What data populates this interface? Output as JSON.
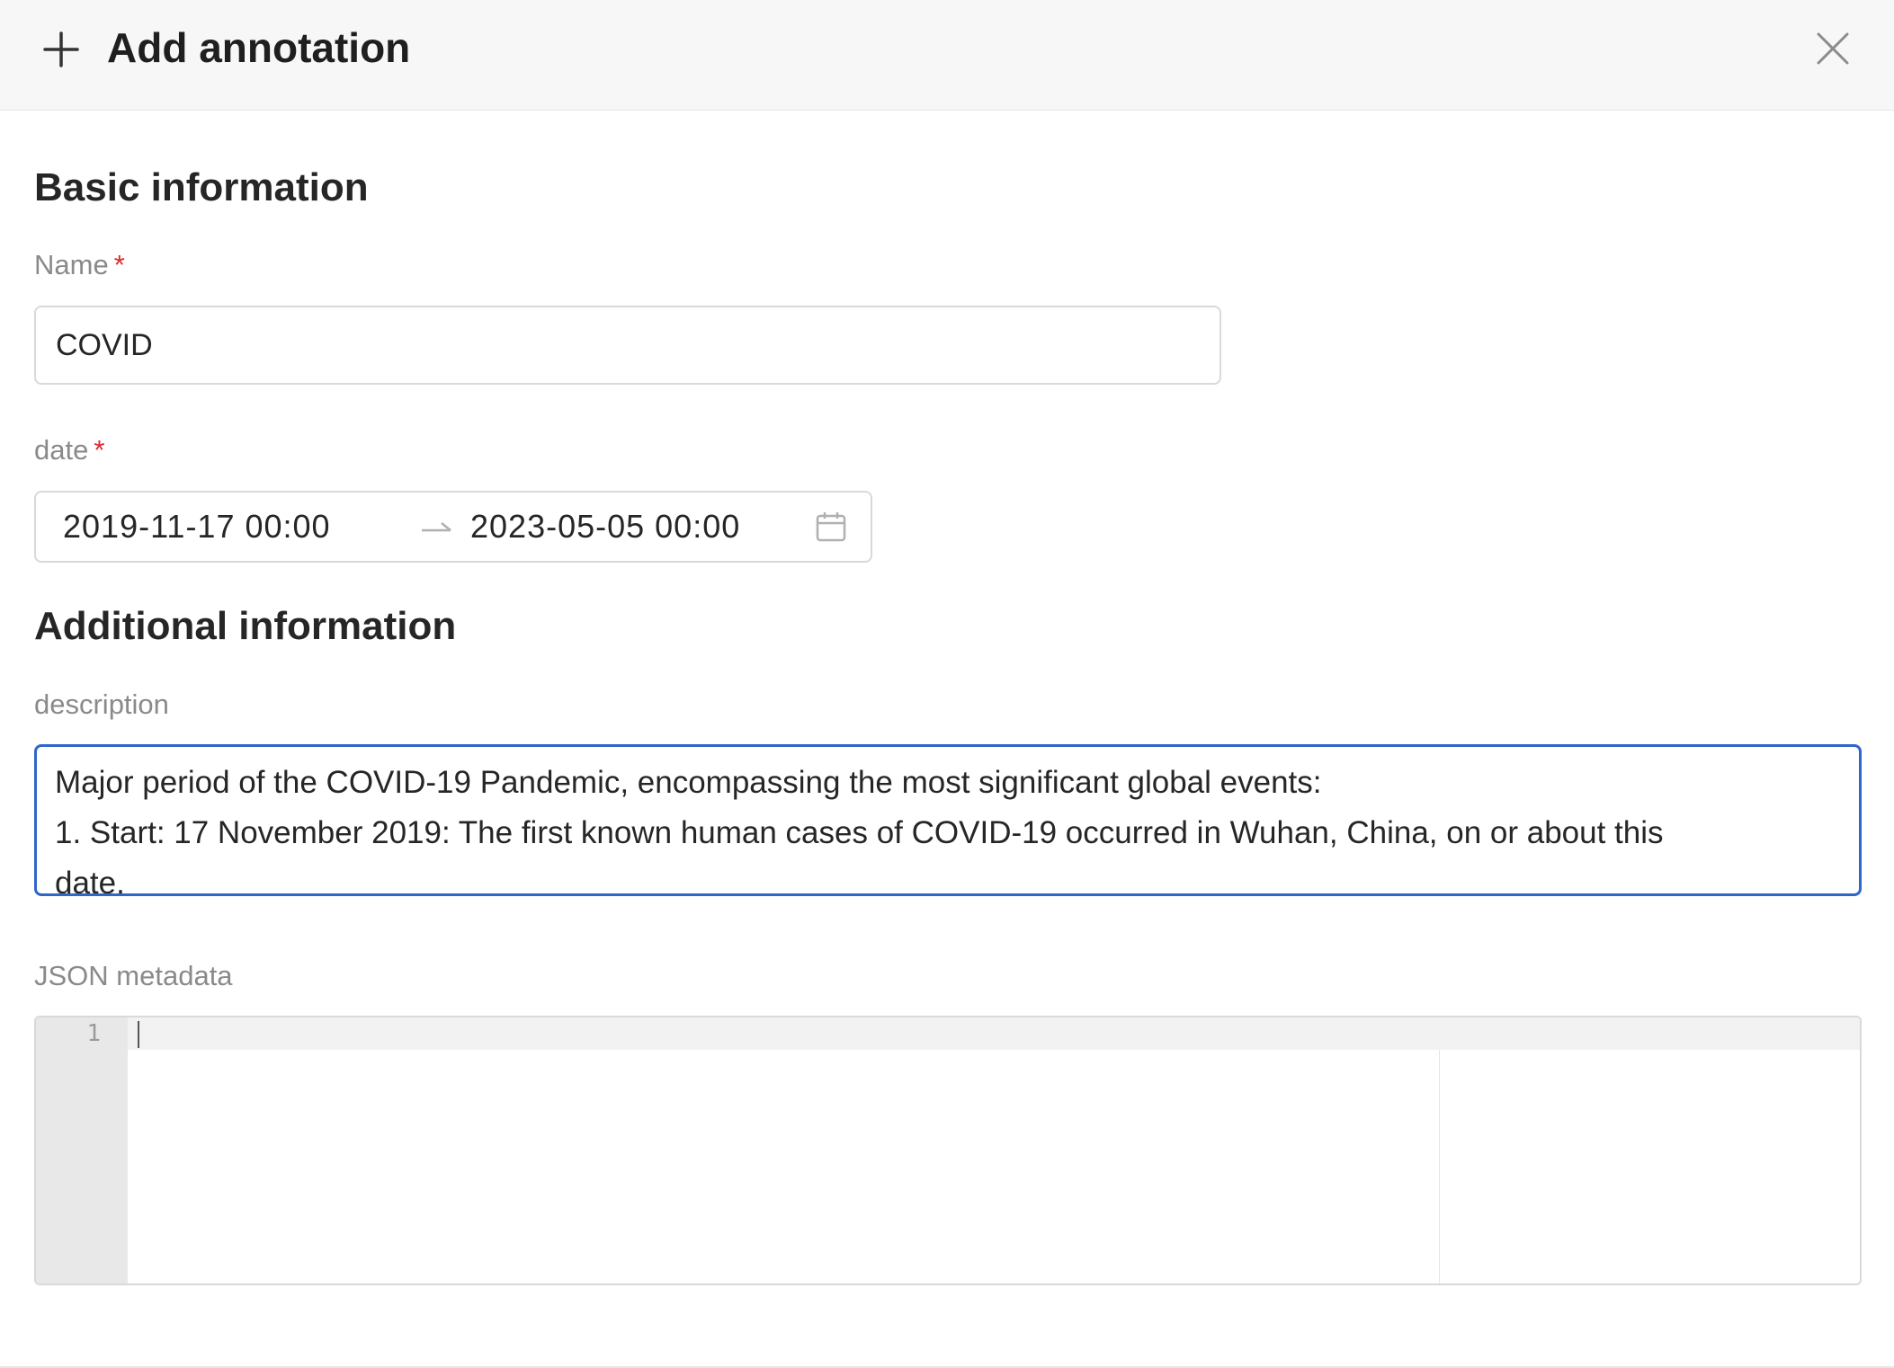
{
  "header": {
    "title": "Add annotation",
    "add_icon": "plus-icon",
    "close_icon": "close-icon"
  },
  "basic_section": {
    "title": "Basic information",
    "name_label": "Name",
    "name_required_mark": "*",
    "name_value": "COVID",
    "date_label": "date",
    "date_required_mark": "*",
    "date_start": "2019-11-17 00:00",
    "date_end": "2023-05-05 00:00",
    "separator_icon": "arrow-right-icon",
    "calendar_icon": "calendar-icon"
  },
  "additional_section": {
    "title": "Additional information",
    "description_label": "description",
    "description_lines": [
      "Major period of the COVID-19 Pandemic, encompassing the most significant global events:",
      "1. Start: 17 November 2019: The first known human cases of COVID-19 occurred in Wuhan, China, on or about this",
      "date."
    ],
    "json_label": "JSON metadata",
    "json_line_number": "1"
  },
  "colors": {
    "header_bg": "#f7f7f7",
    "focus_border": "#2f66c9",
    "required": "#e0282e",
    "label": "#8a8a8a"
  }
}
